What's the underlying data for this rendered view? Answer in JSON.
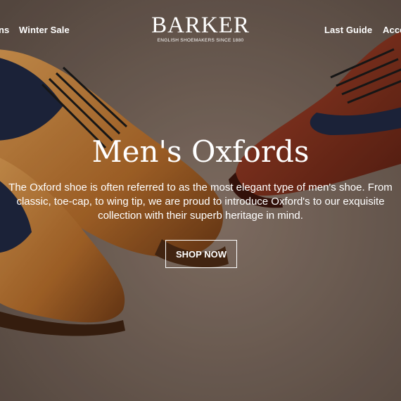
{
  "brand": {
    "name": "BARKER",
    "tagline": "ENGLISH SHOEMAKERS SINCE 1880"
  },
  "nav": {
    "left_partial": "ns",
    "winter_sale": "Winter Sale",
    "last_guide": "Last Guide",
    "right_partial": "Acce"
  },
  "hero": {
    "title": "Men's Oxfords",
    "description": "The Oxford shoe is often referred to as the most elegant type of men's shoe. From classic, toe-cap, to wing tip, we are proud to introduce Oxford's to our exquisite collection with their superb heritage in mind.",
    "cta": "SHOP NOW"
  },
  "colors": {
    "background": "#7a675b",
    "tan_leather": "#b8742f",
    "brown_leather": "#7a2e1c",
    "navy_suede": "#1f2740",
    "text": "#ffffff"
  }
}
